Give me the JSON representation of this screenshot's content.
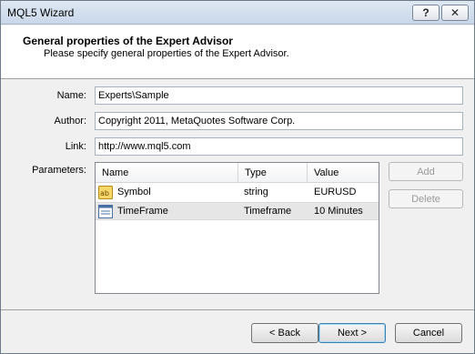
{
  "window": {
    "title": "MQL5 Wizard"
  },
  "titlebar": {
    "help_label": "?",
    "close_label": "✕"
  },
  "header": {
    "title": "General properties of the Expert Advisor",
    "subtitle": "Please specify general properties of the Expert Advisor."
  },
  "form": {
    "name_label": "Name:",
    "name_value": "Experts\\Sample",
    "author_label": "Author:",
    "author_value": "Copyright 2011, MetaQuotes Software Corp.",
    "link_label": "Link:",
    "link_value": "http://www.mql5.com",
    "parameters_label": "Parameters:"
  },
  "parameters": {
    "columns": [
      "Name",
      "Type",
      "Value"
    ],
    "rows": [
      {
        "name": "Symbol",
        "type": "string",
        "value": "EURUSD",
        "icon": "string-param-icon",
        "selected": false
      },
      {
        "name": "TimeFrame",
        "type": "Timeframe",
        "value": "10 Minutes",
        "icon": "timeframe-param-icon",
        "selected": true
      }
    ]
  },
  "side_buttons": {
    "add_label": "Add",
    "delete_label": "Delete"
  },
  "footer": {
    "back_label": "< Back",
    "next_label": "Next >",
    "cancel_label": "Cancel"
  }
}
